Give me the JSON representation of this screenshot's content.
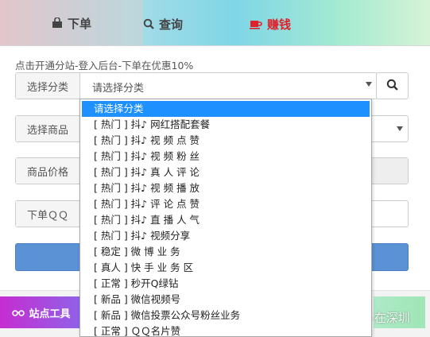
{
  "tabs": [
    {
      "label": "下单",
      "icon": "shopping-bag-icon"
    },
    {
      "label": "查询",
      "icon": "search-icon"
    },
    {
      "label": "赚钱",
      "icon": "coffee-cup-icon",
      "color": "#e0202a"
    }
  ],
  "notice": "点击开通分站-登入后台-下单在优惠10%",
  "form": {
    "category_label": "选择分类",
    "category_value": "请选择分类",
    "product_label": "选择商品",
    "price_label": "商品价格",
    "qq_label": "下单ＱＱ"
  },
  "dropdown_options": [
    "请选择分类",
    "[ 热门 ] 抖♪ 网红搭配套餐",
    "[ 热门 ] 抖♪ 视 频 点 赞",
    "[ 热门 ] 抖♪ 视 频 粉 丝",
    "[ 热门 ] 抖♪ 真 人 评 论",
    "[ 热门 ] 抖♪ 视 频 播 放",
    "[ 热门 ] 抖♪ 评 论 点 赞",
    "[ 热门 ] 抖♪ 直 播 人 气",
    "[ 热门 ] 抖♪ 视频分享",
    "[ 稳定 ] 微 博 业 务",
    "[ 真人 ] 快 手 业 务 区",
    "[ 正常 ] 秒开Q绿钻",
    "[ 新品 ] 微信视频号",
    "[ 新品 ] 微信投票公众号粉丝业务",
    "[ 正常 ] ＱＱ名片赞"
  ],
  "bottom": {
    "site_tools_label": "站点工具"
  },
  "watermark": "知乎 @毛小白奋斗在深圳",
  "colors": {
    "accent": "#1e90ff",
    "submit": "#5b92d6",
    "earn": "#e0202a"
  }
}
